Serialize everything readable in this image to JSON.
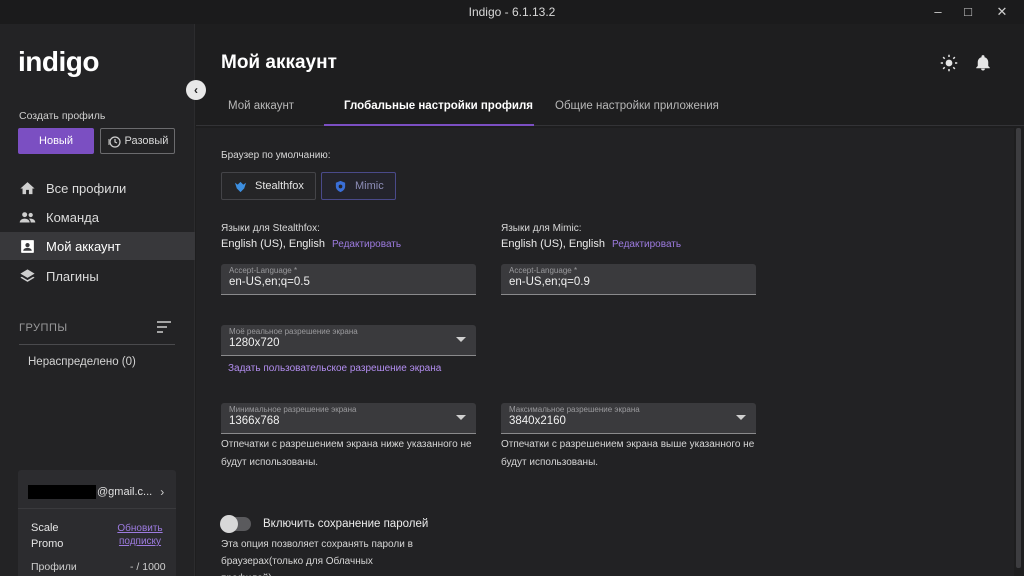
{
  "window": {
    "title": "Indigo - 6.1.13.2"
  },
  "sidebar": {
    "logo": "indigo",
    "create_profile_label": "Создать профиль",
    "new_button": "Новый",
    "once_button": "Разовый",
    "nav": [
      {
        "label": "Все профили",
        "icon": "home-icon"
      },
      {
        "label": "Команда",
        "icon": "team-icon"
      },
      {
        "label": "Мой аккаунт",
        "icon": "account-icon",
        "active": true
      },
      {
        "label": "Плагины",
        "icon": "layers-icon"
      }
    ],
    "groups_label": "ГРУППЫ",
    "group_item": "Нераспределено  (0)",
    "account": {
      "email_suffix": "@gmail.c...",
      "plan_name": "Scale Promo",
      "update_link": "Обновить подписку",
      "profiles_label": "Профили",
      "profiles_value": "- / 1000"
    }
  },
  "main": {
    "title": "Мой аккаунт",
    "tabs": [
      {
        "label": "Мой аккаунт"
      },
      {
        "label": "Глобальные настройки профиля",
        "active": true
      },
      {
        "label": "Общие настройки приложения"
      }
    ],
    "default_browser_label": "Браузер по умолчанию:",
    "browsers": [
      {
        "label": "Stealthfox"
      },
      {
        "label": "Mimic",
        "selected": true
      }
    ],
    "stealthfox": {
      "langs_label": "Языки для Stealthfox:",
      "langs_value": "English (US), English",
      "edit": "Редактировать",
      "accept_language_label": "Accept-Language *",
      "accept_language_value": "en-US,en;q=0.5"
    },
    "mimic": {
      "langs_label": "Языки для Mimic:",
      "langs_value": "English (US), English",
      "edit": "Редактировать",
      "accept_language_label": "Accept-Language *",
      "accept_language_value": "en-US,en;q=0.9"
    },
    "real_resolution": {
      "label": "Моё реальное разрешение экрана",
      "value": "1280x720"
    },
    "custom_resolution_link": "Задать пользовательское разрешение экрана",
    "min_resolution": {
      "label": "Минимальное разрешение экрана",
      "value": "1366x768",
      "hint_line1": "Отпечатки с разрешением экрана ниже указанного не",
      "hint_line2": "будут использованы."
    },
    "max_resolution": {
      "label": "Максимальное разрешение экрана",
      "value": "3840x2160",
      "hint_line1": "Отпечатки с разрешением экрана выше указанного не",
      "hint_line2": "будут использованы."
    },
    "password_saving": {
      "label": "Включить сохранение паролей",
      "hint_line1": "Эта опция позволяет сохранять пароли в",
      "hint_line2": "браузерах(только для Облачных профилей).",
      "enabled": false
    }
  },
  "colors": {
    "accent": "#7b4fc2",
    "link": "#9d7be0"
  }
}
